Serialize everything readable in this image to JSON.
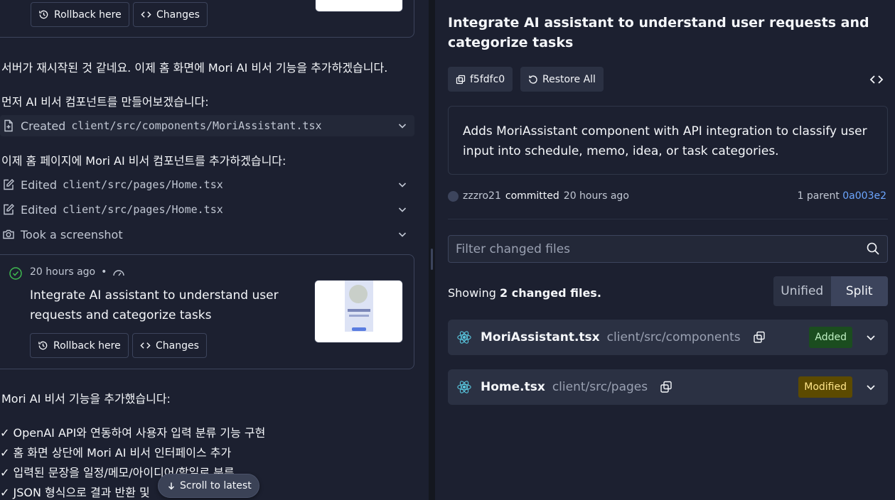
{
  "left": {
    "card1": {
      "rollback_label": "Rollback here",
      "changes_label": "Changes"
    },
    "para1": "서버가 재시작된 것 같네요. 이제 홈 화면에 Mori AI 비서 기능을 추가하겠습니다.",
    "para2": "먼저 AI 비서 컴포넌트를 만들어보겠습니다:",
    "action_created": {
      "verb": "Created",
      "path": "client/src/components/MoriAssistant.tsx"
    },
    "para3": "이제 홈 페이지에 Mori AI 비서 컴포넌트를 추가하겠습니다:",
    "action_edited1": {
      "verb": "Edited",
      "path": "client/src/pages/Home.tsx"
    },
    "action_edited2": {
      "verb": "Edited",
      "path": "client/src/pages/Home.tsx"
    },
    "action_screenshot": {
      "label": "Took a screenshot"
    },
    "card2": {
      "time": "20 hours ago",
      "separator": "•",
      "title": "Integrate AI assistant to understand user requests and categorize tasks",
      "rollback_label": "Rollback here",
      "changes_label": "Changes"
    },
    "para4": "Mori AI 비서 기능을 추가했습니다:",
    "checklist": [
      "✓ OpenAI API와 연동하여 사용자 입력 분류 기능 구현",
      "✓ 홈 화면 상단에 Mori AI 비서 인터페이스 추가",
      "✓ 입력된 문장을 일정/메모/아이디어/할일로 분류",
      "✓ JSON 형식으로 결과 반환 및"
    ],
    "scroll_latest_label": "Scroll to latest"
  },
  "right": {
    "commit_title": "Integrate AI assistant to understand user requests and categorize tasks",
    "commit_hash": "f5fdfc0",
    "restore_label": "Restore All",
    "description": "Adds MoriAssistant component with API integration to classify user input into schedule, memo, idea, or task categories.",
    "author": "zzzro21",
    "committed_label": "committed",
    "committed_time": "20 hours ago",
    "parent_prefix": "1 parent",
    "parent_hash": "0a003e2",
    "filter_placeholder": "Filter changed files",
    "showing_prefix": "Showing ",
    "showing_count": "2 changed files.",
    "view_unified": "Unified",
    "view_split": "Split",
    "active_view": "Split",
    "files": [
      {
        "name": "MoriAssistant.tsx",
        "path": "client/src/components",
        "status": "Added"
      },
      {
        "name": "Home.tsx",
        "path": "client/src/pages",
        "status": "Modified"
      }
    ]
  },
  "colors": {
    "background": "#1c2030",
    "panel": "#2b3143",
    "border": "#3c445c",
    "link": "#6ca6ff",
    "added_bg": "#1b4d1f",
    "modified_bg": "#5c4a00",
    "react_icon": "#58c4dc",
    "success": "#3fb950"
  }
}
